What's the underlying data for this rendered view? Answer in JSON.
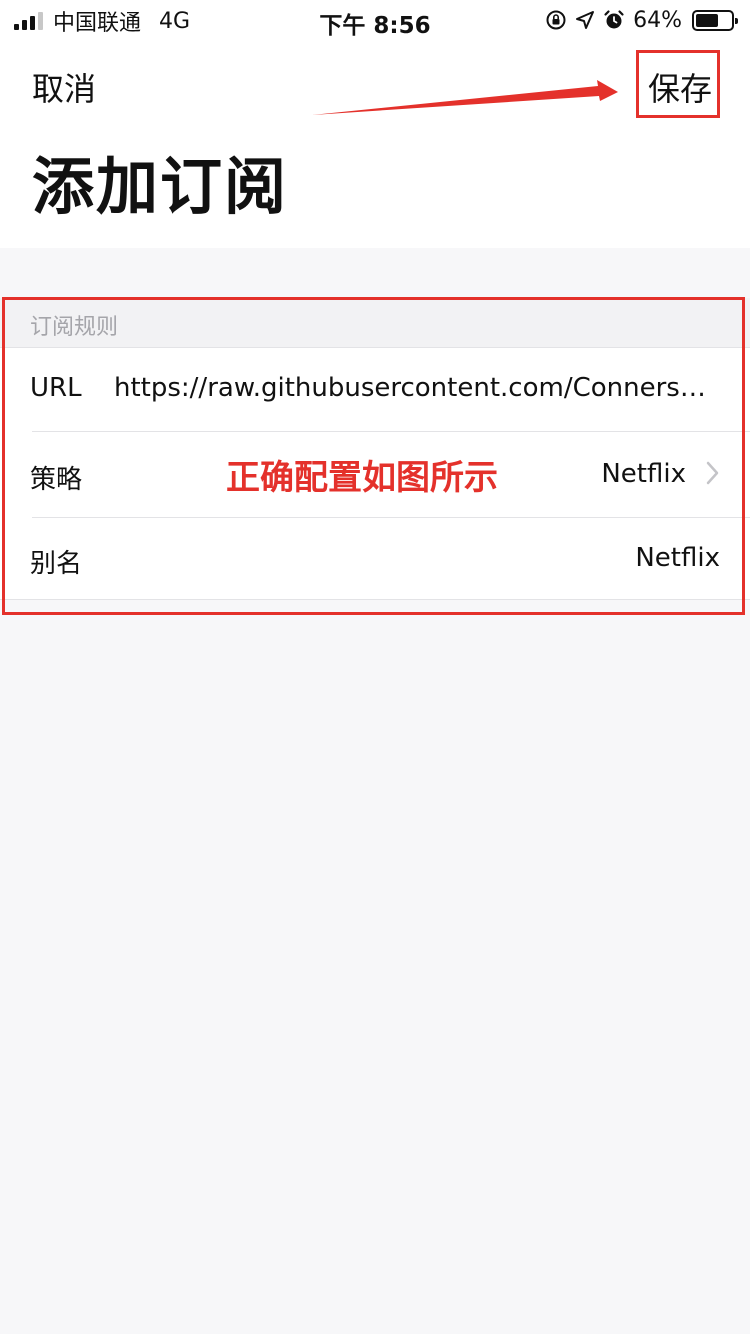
{
  "status_bar": {
    "carrier": "中国联通",
    "network": "4G",
    "time": "下午 8:56",
    "battery_percent": "64%",
    "battery_level": 0.64
  },
  "nav": {
    "cancel_label": "取消",
    "save_label": "保存"
  },
  "page": {
    "title": "添加订阅"
  },
  "section": {
    "title": "订阅规则"
  },
  "rows": [
    {
      "label": "URL",
      "value": "https://raw.githubusercontent.com/ConnersHua/Profiles/master/Surge/Ruleset/Media/Netflix.list"
    },
    {
      "label": "策略",
      "value": "Netflix"
    },
    {
      "label": "别名",
      "value": "Netflix"
    }
  ],
  "annotation": {
    "note": "正确配置如图所示",
    "color": "#e4312b"
  },
  "icons": [
    "signal-icon",
    "orientation-lock-icon",
    "location-icon",
    "alarm-icon",
    "battery-icon",
    "chevron-right-icon",
    "arrow-annotation-icon"
  ]
}
